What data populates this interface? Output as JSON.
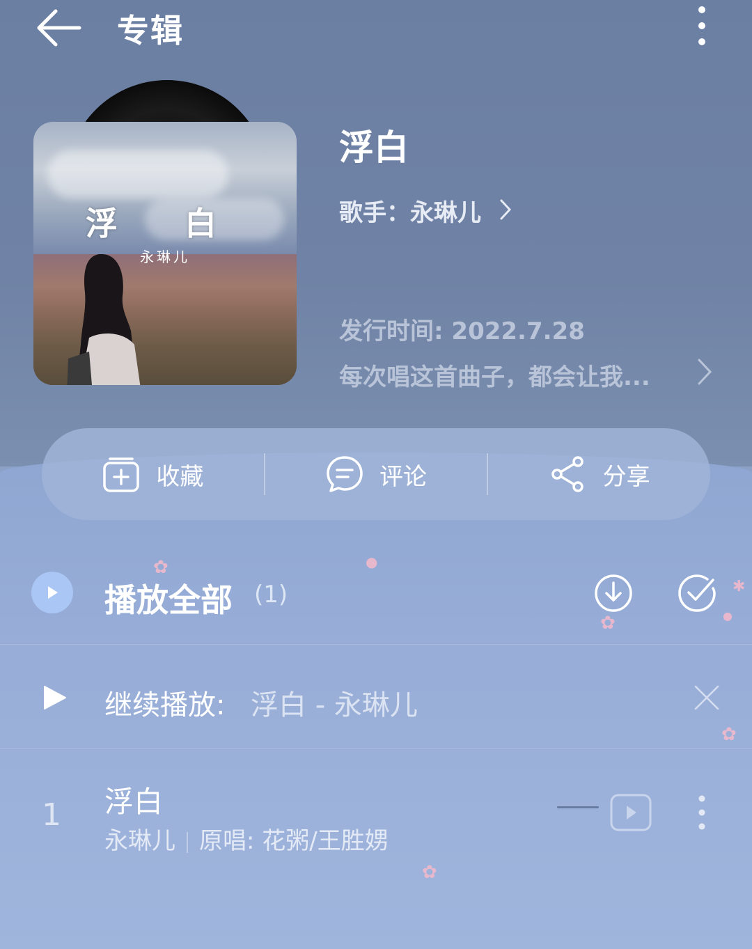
{
  "header": {
    "title": "专辑",
    "back_icon": "arrow-left-icon",
    "more_icon": "more-vertical-icon"
  },
  "album": {
    "cover_title": "浮 白",
    "cover_artist": "永琳儿",
    "name": "浮白",
    "artist_label": "歌手：永琳儿",
    "release": "发行时间: 2022.7.28",
    "description": "每次唱这首曲子，都会让我..."
  },
  "actions": [
    {
      "label": "收藏",
      "icon": "add-collection-icon"
    },
    {
      "label": "评论",
      "icon": "comment-icon"
    },
    {
      "label": "分享",
      "icon": "share-icon"
    }
  ],
  "play_all": {
    "label": "播放全部",
    "count": "(1)"
  },
  "resume": {
    "label": "继续播放:",
    "song": "浮白 - 永琳儿"
  },
  "tracks": [
    {
      "number": "1",
      "title": "浮白",
      "artist": "永琳儿",
      "original": "原唱: 花粥/王胜娚"
    }
  ],
  "colors": {
    "accent": "#aac6f5",
    "bg_top": "#6f83a6",
    "bg_bottom": "#9fb5dc"
  }
}
